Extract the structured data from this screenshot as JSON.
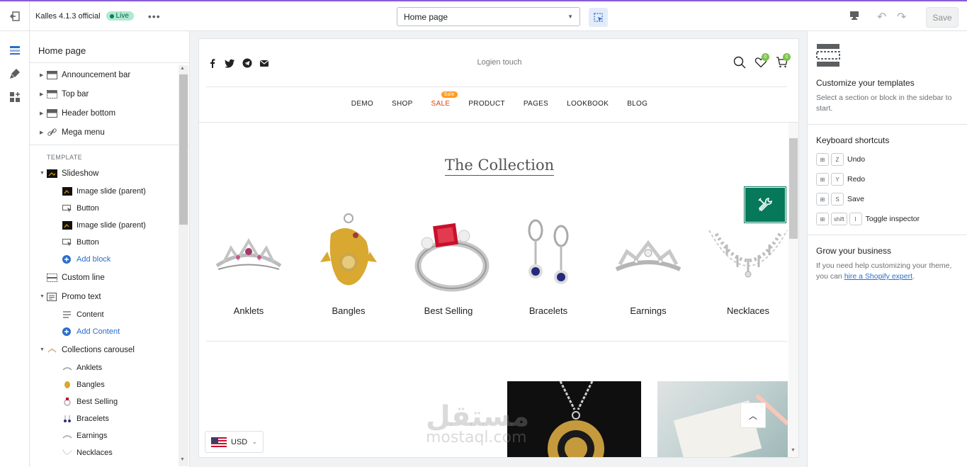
{
  "topbar": {
    "theme_name": "Kalles 4.1.3 official",
    "live_label": "Live",
    "page_select": "Home page",
    "save_label": "Save"
  },
  "sidebar": {
    "title": "Home page",
    "header_sections": [
      {
        "label": "Announcement bar"
      },
      {
        "label": "Top bar"
      },
      {
        "label": "Header bottom"
      },
      {
        "label": "Mega menu"
      }
    ],
    "template_label": "TEMPLATE",
    "slideshow": {
      "label": "Slideshow",
      "children": [
        "Image slide (parent)",
        "Button",
        "Image slide (parent)",
        "Button"
      ],
      "add_label": "Add block"
    },
    "custom_line": "Custom line",
    "promo_text": {
      "label": "Promo text",
      "children": [
        "Content"
      ],
      "add_label": "Add Content"
    },
    "collections_carousel": {
      "label": "Collections carousel",
      "children": [
        "Anklets",
        "Bangles",
        "Best Selling",
        "Bracelets",
        "Earnings",
        "Necklaces"
      ]
    }
  },
  "preview": {
    "site_title": "Logien touch",
    "wishlist_count": "0",
    "cart_count": "0",
    "nav": [
      "DEMO",
      "SHOP",
      "SALE",
      "PRODUCT",
      "PAGES",
      "LOOKBOOK",
      "BLOG"
    ],
    "sale_badge": "Sale",
    "collection_title": "The Collection",
    "collections": [
      "Anklets",
      "Bangles",
      "Best Selling",
      "Bracelets",
      "Earnings",
      "Necklaces"
    ],
    "currency": "USD",
    "watermark_ar": "مستقل",
    "watermark_en": "mostaql.com"
  },
  "right_panel": {
    "customize_title": "Customize your templates",
    "customize_text": "Select a section or block in the sidebar to start.",
    "shortcuts_title": "Keyboard shortcuts",
    "shortcuts": [
      {
        "keys": [
          "⊞",
          "Z"
        ],
        "action": "Undo"
      },
      {
        "keys": [
          "⊞",
          "Y"
        ],
        "action": "Redo"
      },
      {
        "keys": [
          "⊞",
          "S"
        ],
        "action": "Save"
      },
      {
        "keys": [
          "⊞",
          "shift",
          "I"
        ],
        "action": "Toggle inspector"
      }
    ],
    "grow_title": "Grow your business",
    "grow_text": "If you need help customizing your theme, you can",
    "grow_link": "hire a Shopify expert",
    "grow_end": "."
  },
  "colors": {
    "accent": "#2c6ecb",
    "live_badge": "#aee9d1",
    "tools_button": "#05795a",
    "sale": "#e1400a",
    "sale_badge": "#ff9b20"
  }
}
